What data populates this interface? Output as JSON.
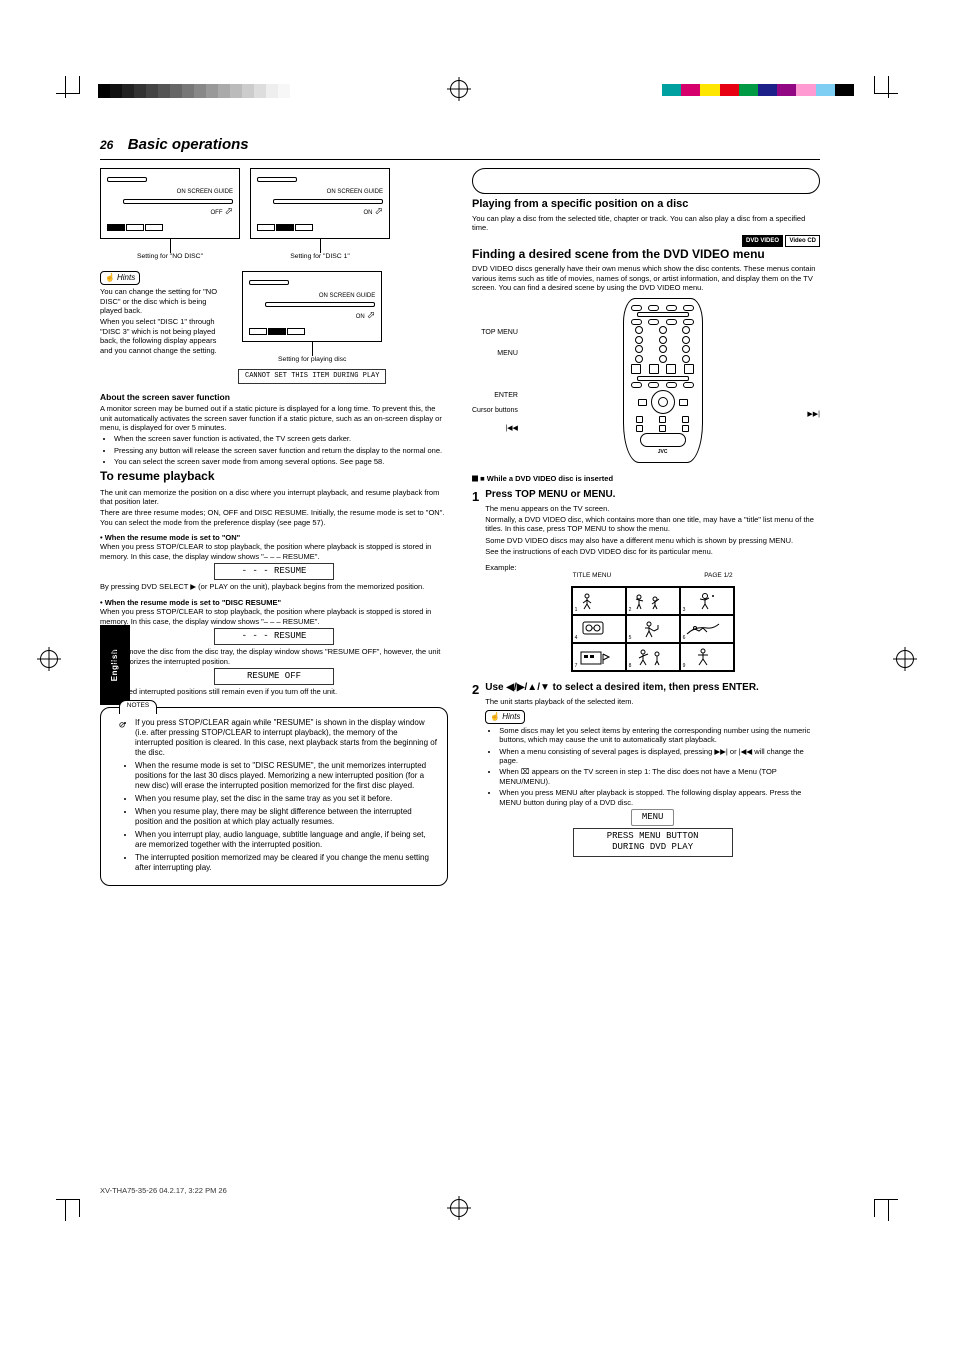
{
  "page": {
    "number": "26",
    "title": "Basic operations"
  },
  "sidebar_tab": "English",
  "col_left": {
    "panel_label_left": "Setting for \"NO DISC\"",
    "panel_label_right": "Setting for \"DISC 1\"",
    "panel_label_playing": "Setting for playing disc",
    "onscreen": {
      "title": "ON SCREEN GUIDE",
      "off": "OFF",
      "on": "ON"
    },
    "hints_label": "Hints",
    "hints_body1": "You can change the setting for \"NO DISC\" or the disc which is being played back.",
    "hints_body2": "When you select \"DISC 1\" through \"DISC 3\" which is not being played back, the following display appears and you cannot change the setting.",
    "cannot_set": "CANNOT SET THIS ITEM DURING PLAY",
    "screensaver_h": "About the screen saver function",
    "screensaver_p1": "A monitor screen may be burned out if a static picture is displayed for a long time. To prevent this, the unit automatically activates the screen saver function if a static picture, such as an on-screen display or menu, is displayed for over 5 minutes.",
    "screensaver_p2": "When the screen saver function is activated, the TV screen gets darker.",
    "screensaver_p3": "Pressing any button will release the screen saver function and return the display to the normal one.",
    "screensaver_p4": "You can select the screen saver mode from among several options. See page 58.",
    "resume_h": "To resume playback",
    "resume_p1": "The unit can memorize the position on a disc where you interrupt playback, and resume playback from that position later.",
    "resume_p2": "There are three resume modes; ON, OFF and DISC RESUME. Initially, the resume mode is set to \"ON\". You can select the mode from the preference display (see page 57).",
    "resume_on_h": "• When the resume mode is set to \"ON\"",
    "resume_on_t": "When you press STOP/CLEAR to stop playback, the position where playback is stopped is stored in memory. In this case, the display window shows \"– – – RESUME\".",
    "resume_input": "- - - RESUME",
    "resume_on_t2": "By pressing DVD SELECT ▶ (or PLAY on the unit), playback begins from the memorized position.",
    "resume_disc_h": "• When the resume mode is set to \"DISC RESUME\"",
    "resume_disc_t": "When you press STOP/CLEAR to stop playback, the position where playback is stopped is stored in memory. In this case, the display window shows \"– – – RESUME\".",
    "resume_input2": "- - - RESUME",
    "resume_disc_t2": "If you remove the disc from the disc tray, the display window shows \"RESUME OFF\", however, the unit still memorizes the interrupted position.",
    "resume_input3": "RESUME OFF",
    "resume_poweroff": "Memorized interrupted positions still remain even if you turn off the unit.",
    "notes_tab": "NOTES",
    "notes": [
      "If you press STOP/CLEAR again while \"RESUME\" is shown in the display window (i.e. after pressing STOP/CLEAR to interrupt playback), the memory of the interrupted position is cleared. In this case, next playback starts from the beginning of the disc.",
      "When the resume mode is set to \"DISC RESUME\", the unit memorizes interrupted positions for the last 30 discs played. Memorizing a new interrupted position (for a new disc) will erase the interrupted position memorized for the first disc played.",
      "When you resume play, set the disc in the same tray as you set it before.",
      "When you resume play, there may be slight difference between the interrupted position and the position at which play actually resumes.",
      "When you interrupt play, audio language, subtitle language and angle, if being set, are memorized together with the interrupted position.",
      "The interrupted position memorized may be cleared if you change the menu setting after interrupting play."
    ]
  },
  "col_right": {
    "banner_h": "Playing from a specific position on a disc",
    "banner_sub": "You can play a disc from the selected title, chapter or track. You can also play a disc from a specified time.",
    "badge_dvd": "DVD\nVIDEO",
    "badge_vcd": "Video\nCD",
    "digest_h": "Finding a desired scene from the DVD VIDEO menu",
    "digest_p1": "DVD VIDEO discs generally have their own menus which show the disc contents. These menus contain various items such as title of movies, names of songs, or artist information, and display them on the TV screen. You can find a desired scene by using the DVD VIDEO menu.",
    "remote_labels": {
      "top_menu": "TOP MENU",
      "menu": "MENU",
      "enter": "ENTER",
      "cursor": "Cursor buttons",
      "skip_next": "▶▶|",
      "skip_prev": "|◀◀"
    },
    "step1_lead": "■ While a DVD VIDEO disc is inserted",
    "step1_num": "1",
    "step1_h": "Press TOP MENU or MENU.",
    "step1_t": "The menu appears on the TV screen.",
    "step1_t2": "Normally, a DVD VIDEO disc, which contains more than one title, may have a \"title\" list menu of the titles. In this case, press TOP MENU to show the menu.",
    "step1_t3": "Some DVD VIDEO discs may also have a different menu which is shown by pressing MENU.",
    "step1_t4": "See the instructions of each DVD VIDEO disc for its particular menu.",
    "digest_example_label": "Example:",
    "digest_title1": "TITLE MENU",
    "digest_pageinfo": "PAGE 1/2",
    "digest_cells": [
      "1",
      "2",
      "3",
      "4",
      "5",
      "6",
      "7",
      "8",
      "9"
    ],
    "step2_num": "2",
    "step2_h": "Use ◀/▶/▲/▼ to select a desired item, then press ENTER.",
    "step2_t": "The unit starts playback of the selected item.",
    "step2_hint_badge": "Hints",
    "step2_hints": [
      "Some discs may let you select items by entering the corresponding number using the numeric buttons, which may cause the unit to automatically start playback.",
      "When a menu consisting of several pages is displayed, pressing ▶▶| or |◀◀ will change the page.",
      "When ⌧ appears on the TV screen in step 1: The disc does not have a Menu (TOP MENU/MENU).",
      "When you press MENU after playback is stopped. The following display appears. Press the MENU button during play of a DVD disc."
    ],
    "menu_btn": "MENU",
    "menu_msg_line1": "PRESS MENU BUTTON",
    "menu_msg_line2": "DURING DVD PLAY"
  },
  "footer": "XV-THA75-35-26  04.2.17, 3:22 PM  26"
}
